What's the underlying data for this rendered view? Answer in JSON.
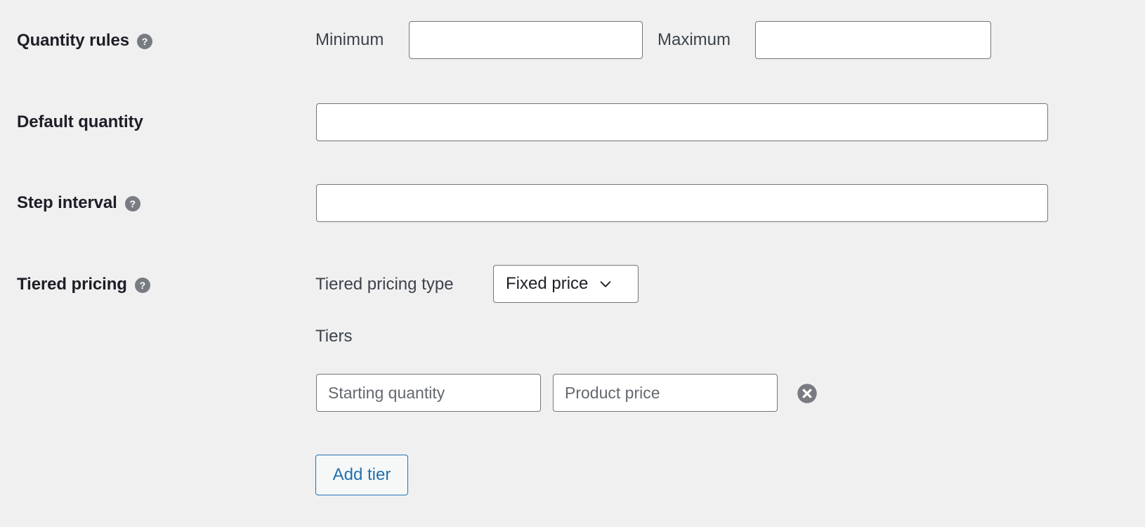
{
  "theme": {
    "page_background": "#f0f0f1",
    "label_color": "#1e1e26",
    "input_border": "#757575",
    "input_background": "#ffffff",
    "placeholder_color": "#646970",
    "help_icon_background": "#787c82",
    "accent_link": "#2271b1",
    "remove_icon_color": "#787c82"
  },
  "rows": {
    "quantity_rules": {
      "label": "Quantity rules",
      "help_icon": "help-icon",
      "help_glyph": "?",
      "minimum_label": "Minimum",
      "minimum_value": "",
      "minimum_placeholder": "",
      "maximum_label": "Maximum",
      "maximum_value": "",
      "maximum_placeholder": ""
    },
    "default_quantity": {
      "label": "Default quantity",
      "value": "",
      "placeholder": ""
    },
    "step_interval": {
      "label": "Step interval",
      "help_icon": "help-icon",
      "help_glyph": "?",
      "value": "",
      "placeholder": ""
    },
    "tiered_pricing": {
      "label": "Tiered pricing",
      "help_icon": "help-icon",
      "help_glyph": "?",
      "type_label": "Tiered pricing type",
      "type_selected": "Fixed price",
      "type_options": [
        "Fixed price"
      ],
      "type_chevron_icon": "chevron-down-icon",
      "tiers_label": "Tiers",
      "tiers": [
        {
          "quantity_value": "",
          "quantity_placeholder": "Starting quantity",
          "price_value": "",
          "price_placeholder": "Product price",
          "remove_icon": "remove-circle-icon"
        }
      ],
      "add_tier_label": "Add tier"
    }
  }
}
